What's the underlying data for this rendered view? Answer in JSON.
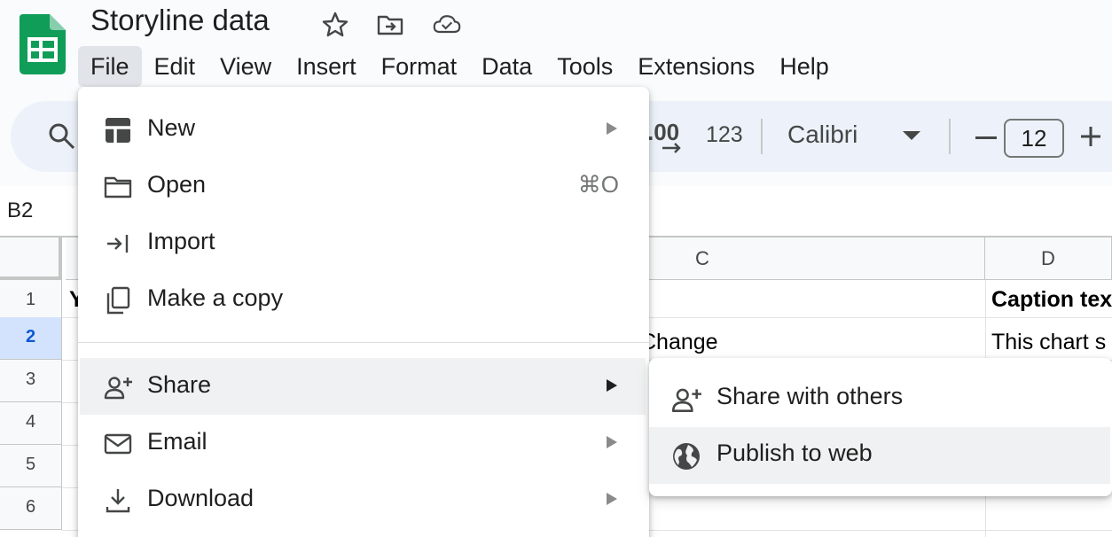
{
  "app": {
    "doc_title": "Storyline data",
    "icons": [
      "sheets-logo-icon",
      "star-icon",
      "move-folder-icon",
      "cloud-saved-icon"
    ]
  },
  "menubar": {
    "items": [
      "File",
      "Edit",
      "View",
      "Insert",
      "Format",
      "Data",
      "Tools",
      "Extensions",
      "Help"
    ],
    "active": "File"
  },
  "toolbar": {
    "decimal_label": ".00",
    "number_format_label": "123",
    "font": "Calibri",
    "font_size": "12"
  },
  "formula_bar": {
    "name_box": "B2"
  },
  "grid": {
    "columns": [
      "C",
      "D"
    ],
    "rows": [
      "1",
      "2",
      "3",
      "4",
      "5",
      "6"
    ],
    "selected_row": "2",
    "cells": {
      "a1_partial": "Y",
      "c2": "Change",
      "d1": "Caption tex",
      "d2": "This chart s"
    }
  },
  "file_menu": {
    "items": [
      {
        "label": "New",
        "icon": "new-sheet-icon",
        "submenu": true
      },
      {
        "label": "Open",
        "icon": "folder-icon",
        "shortcut": "⌘O"
      },
      {
        "label": "Import",
        "icon": "import-icon"
      },
      {
        "label": "Make a copy",
        "icon": "copy-icon"
      },
      {
        "label": "Share",
        "icon": "person-add-icon",
        "submenu": true,
        "hovered": true
      },
      {
        "label": "Email",
        "icon": "email-icon",
        "submenu": true
      },
      {
        "label": "Download",
        "icon": "download-icon",
        "submenu": true
      }
    ]
  },
  "share_submenu": {
    "items": [
      {
        "label": "Share with others",
        "icon": "person-add-icon"
      },
      {
        "label": "Publish to web",
        "icon": "globe-icon",
        "hovered": true
      }
    ]
  },
  "colors": {
    "sheets_green": "#0f9d58",
    "toolbar_bg": "#edf2fa",
    "selected_row_bg": "#d3e3fd",
    "hover_bg": "#eff1f2"
  }
}
